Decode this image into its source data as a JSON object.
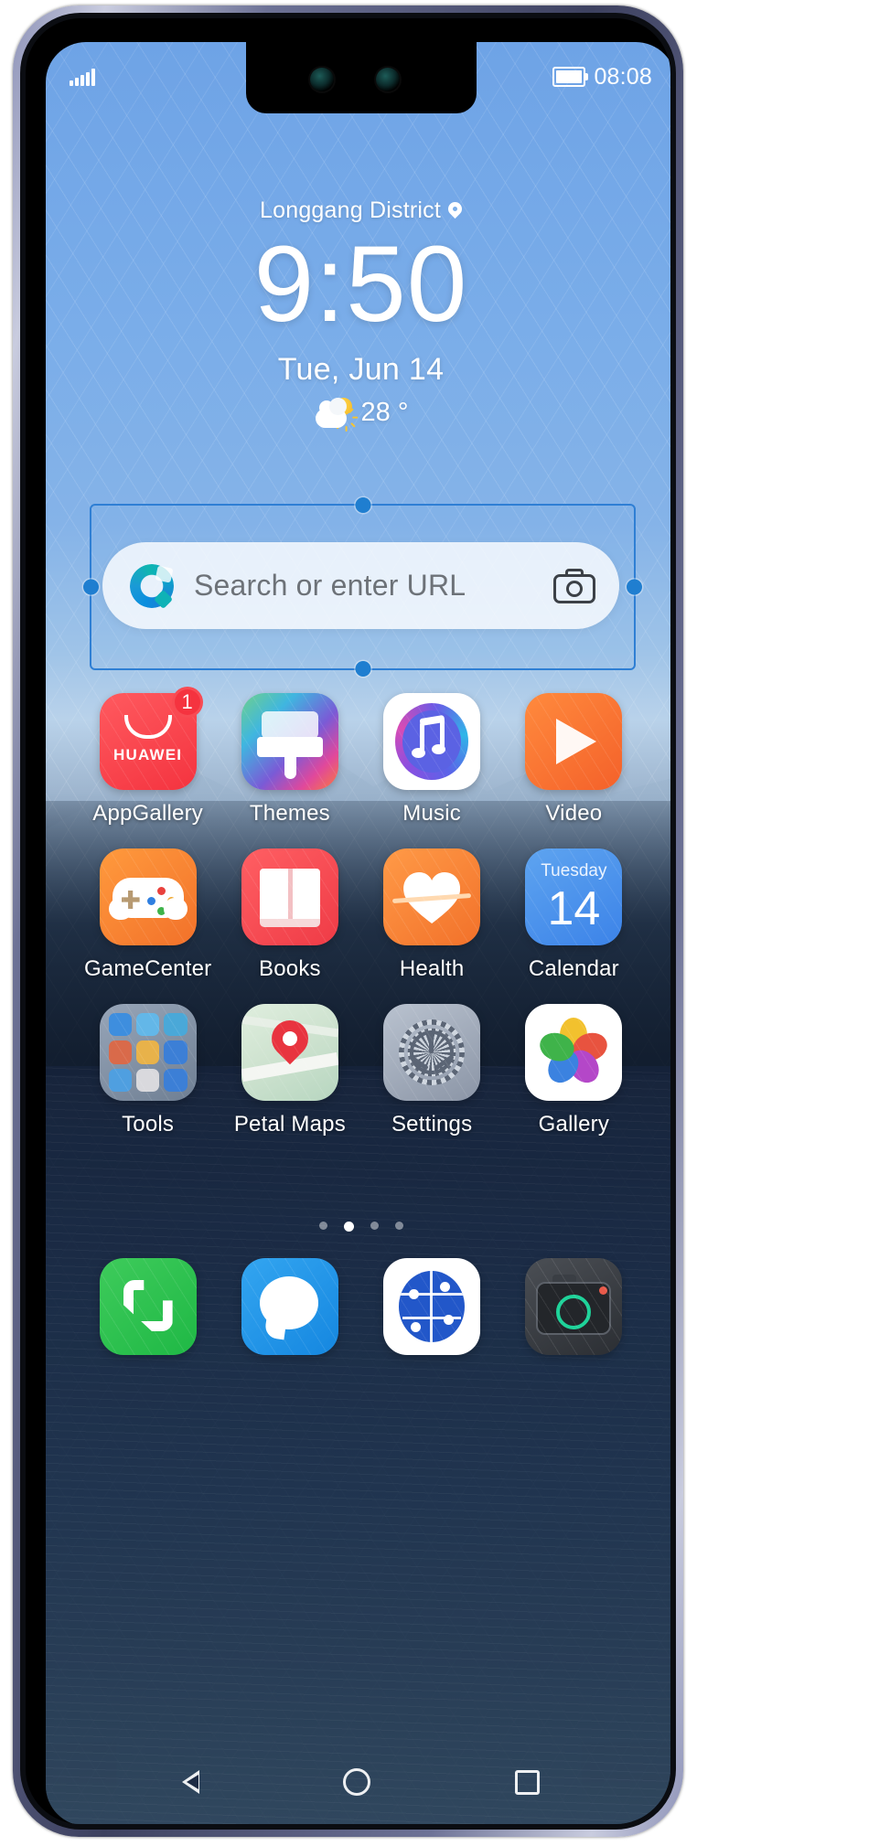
{
  "device": {
    "name": "huawei-phone"
  },
  "status_bar": {
    "signal_icon": "signal-bars-icon",
    "battery_icon": "battery-icon",
    "time": "08:08"
  },
  "clock_widget": {
    "location": "Longgang District",
    "location_icon": "location-pin-icon",
    "time": "9:50",
    "date": "Tue, Jun 14",
    "weather_icon": "partly-cloudy-icon",
    "temperature": "28 °"
  },
  "search_widget": {
    "logo_icon": "petal-search-icon",
    "placeholder": "Search or enter URL",
    "camera_icon": "camera-icon",
    "selected": true,
    "resize_handles": [
      "top",
      "right",
      "bottom",
      "left"
    ],
    "selection_color": "#2f7fd4"
  },
  "home_screen": {
    "rows": [
      [
        {
          "label": "AppGallery",
          "icon": "appgallery-icon",
          "brand": "HUAWEI",
          "badge": "1"
        },
        {
          "label": "Themes",
          "icon": "themes-icon"
        },
        {
          "label": "Music",
          "icon": "music-icon"
        },
        {
          "label": "Video",
          "icon": "video-icon"
        }
      ],
      [
        {
          "label": "GameCenter",
          "icon": "gamecenter-icon"
        },
        {
          "label": "Books",
          "icon": "books-icon"
        },
        {
          "label": "Health",
          "icon": "health-icon"
        },
        {
          "label": "Calendar",
          "icon": "calendar-icon",
          "weekday": "Tuesday",
          "day": "14"
        }
      ],
      [
        {
          "label": "Tools",
          "icon": "tools-folder-icon"
        },
        {
          "label": "Petal Maps",
          "icon": "petal-maps-icon"
        },
        {
          "label": "Settings",
          "icon": "settings-icon"
        },
        {
          "label": "Gallery",
          "icon": "gallery-icon"
        }
      ]
    ],
    "page_dots": {
      "count": 4,
      "active_index": 1
    },
    "dock": [
      {
        "label": "Phone",
        "icon": "phone-icon"
      },
      {
        "label": "Messages",
        "icon": "messages-icon"
      },
      {
        "label": "Browser",
        "icon": "browser-icon"
      },
      {
        "label": "Camera",
        "icon": "camera-app-icon"
      }
    ]
  },
  "nav_bar": {
    "back_icon": "back-triangle-icon",
    "home_icon": "home-circle-icon",
    "recents_icon": "recents-square-icon"
  }
}
